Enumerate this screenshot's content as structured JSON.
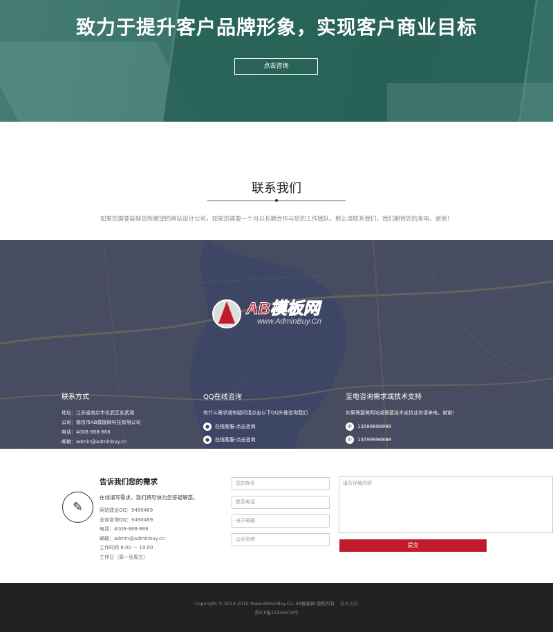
{
  "hero": {
    "title": "致力于提升客户品牌形象，实现客户商业目标",
    "cta_label": "点击咨询"
  },
  "contact": {
    "title": "联系我们",
    "subtitle": "如果您需要能够您所期望的网站设计公司，如果您需要一个可以长期合作与您的工作团队，那么请联系我们，我们期待您的来电，谢谢！"
  },
  "map": {
    "watermark_brand": "AB模板网",
    "watermark_url": "www.AdminBuy.Cn",
    "columns": {
      "info": {
        "title": "联系方式",
        "lines": [
          "地址：江苏省南京市玄武区玄武湖",
          "公司：南京市AB模版网科技有限公司",
          "电话：4008-888-888",
          "邮箱：admin@adminbuy.cn"
        ]
      },
      "qq": {
        "title": "QQ在线咨询",
        "note": "有什么需求或有疑问请点击以下QQ头像咨询我们",
        "items": [
          "在线客服-点击咨询",
          "在线客服-点击咨询"
        ]
      },
      "phone": {
        "title": "至电咨询需求或技术支持",
        "note": "如果需要做网站或需要技术支持业务请来电，谢谢！",
        "items": [
          "13588889999",
          "13599998888"
        ]
      }
    }
  },
  "needs": {
    "title": "告诉我们您的需求",
    "intro": "在线填写需求，我们将尽快为您答疑解惑。",
    "rows": [
      "网站建设QQ：9490489",
      "业务咨询QQ：9490489",
      "电话：4008-888-888",
      "邮箱：admin@adminbuy.cn",
      "工作时间 9:00 － 19:00",
      "工作日（周一至周五）"
    ]
  },
  "form": {
    "name_placeholder": "您的姓名",
    "phone_placeholder": "联系电话",
    "email_placeholder": "电子邮箱",
    "company_placeholder": "公司名称",
    "message_placeholder": "填写详细内容",
    "submit_label": "提交"
  },
  "footer": {
    "copyright": "Copyright © 2014-2015 Www.AdminBuy.Cn. AB模板网 版权所有",
    "link": "技术支持",
    "icp": "苏ICP备12345678号"
  },
  "colors": {
    "accent": "#c21c2c",
    "hero": "#3f7a72",
    "footer": "#222222"
  }
}
